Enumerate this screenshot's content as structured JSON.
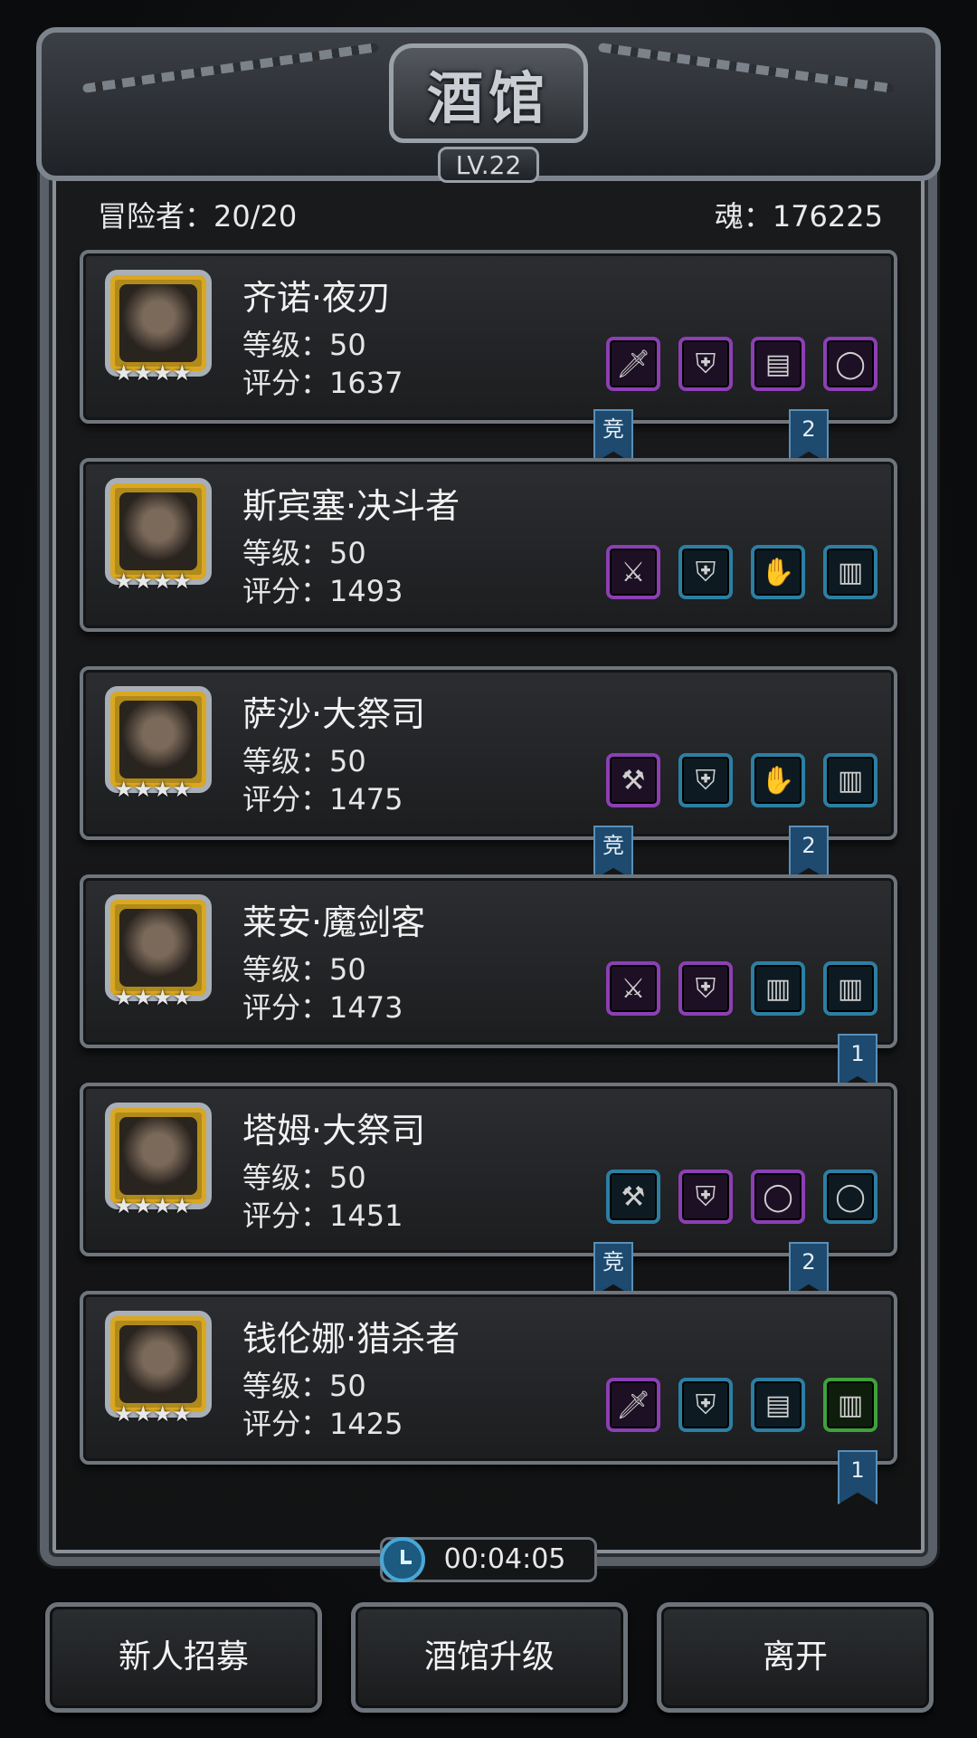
{
  "header": {
    "title": "酒馆",
    "level": "LV.22"
  },
  "stats": {
    "adventurers": "冒险者：20/20",
    "soul": "魂：176225"
  },
  "heroes": [
    {
      "name": "齐诺·夜刃",
      "level": "等级：50",
      "score": "评分：1637",
      "stars": "★★★★",
      "equipment": [
        "dagger-icon",
        "armor-icon",
        "wood-staff-icon",
        "ring-icon"
      ],
      "ribbons": [
        "竞",
        "2"
      ]
    },
    {
      "name": "斯宾塞·决斗者",
      "level": "等级：50",
      "score": "评分：1493",
      "stars": "★★★★",
      "equipment": [
        "sword-icon",
        "armor-icon",
        "gauntlet-icon",
        "barrel-icon"
      ],
      "ribbons": []
    },
    {
      "name": "萨沙·大祭司",
      "level": "等级：50",
      "score": "评分：1475",
      "stars": "★★★★",
      "equipment": [
        "hammer-icon",
        "armor-icon",
        "gauntlet-icon",
        "barrel-icon"
      ],
      "ribbons": [
        "竞",
        "2"
      ]
    },
    {
      "name": "莱安·魔剑客",
      "level": "等级：50",
      "score": "评分：1473",
      "stars": "★★★★",
      "equipment": [
        "sword-icon",
        "armor-icon",
        "barrel-icon",
        "barrel-icon"
      ],
      "ribbons": [
        "1"
      ]
    },
    {
      "name": "塔姆·大祭司",
      "level": "等级：50",
      "score": "评分：1451",
      "stars": "★★★★",
      "equipment": [
        "hammer-icon",
        "armor-icon",
        "ring-icon",
        "ring-icon"
      ],
      "ribbons": [
        "竞",
        "2"
      ]
    },
    {
      "name": "钱伦娜·猎杀者",
      "level": "等级：50",
      "score": "评分：1425",
      "stars": "★★★★",
      "equipment": [
        "dagger-icon",
        "armor-icon",
        "wood-staff-icon",
        "barrel-icon"
      ],
      "ribbons": [
        "1"
      ]
    }
  ],
  "timer": "00:04:05",
  "buttons": {
    "recruit": "新人招募",
    "upgrade": "酒馆升级",
    "leave": "离开"
  },
  "colors": {
    "epic": "#8c3fb5",
    "rare": "#2c7fa3",
    "uncommon": "#3da23a",
    "ribbon": "#1d4a6e",
    "portrait_gold": "#d9a722"
  }
}
